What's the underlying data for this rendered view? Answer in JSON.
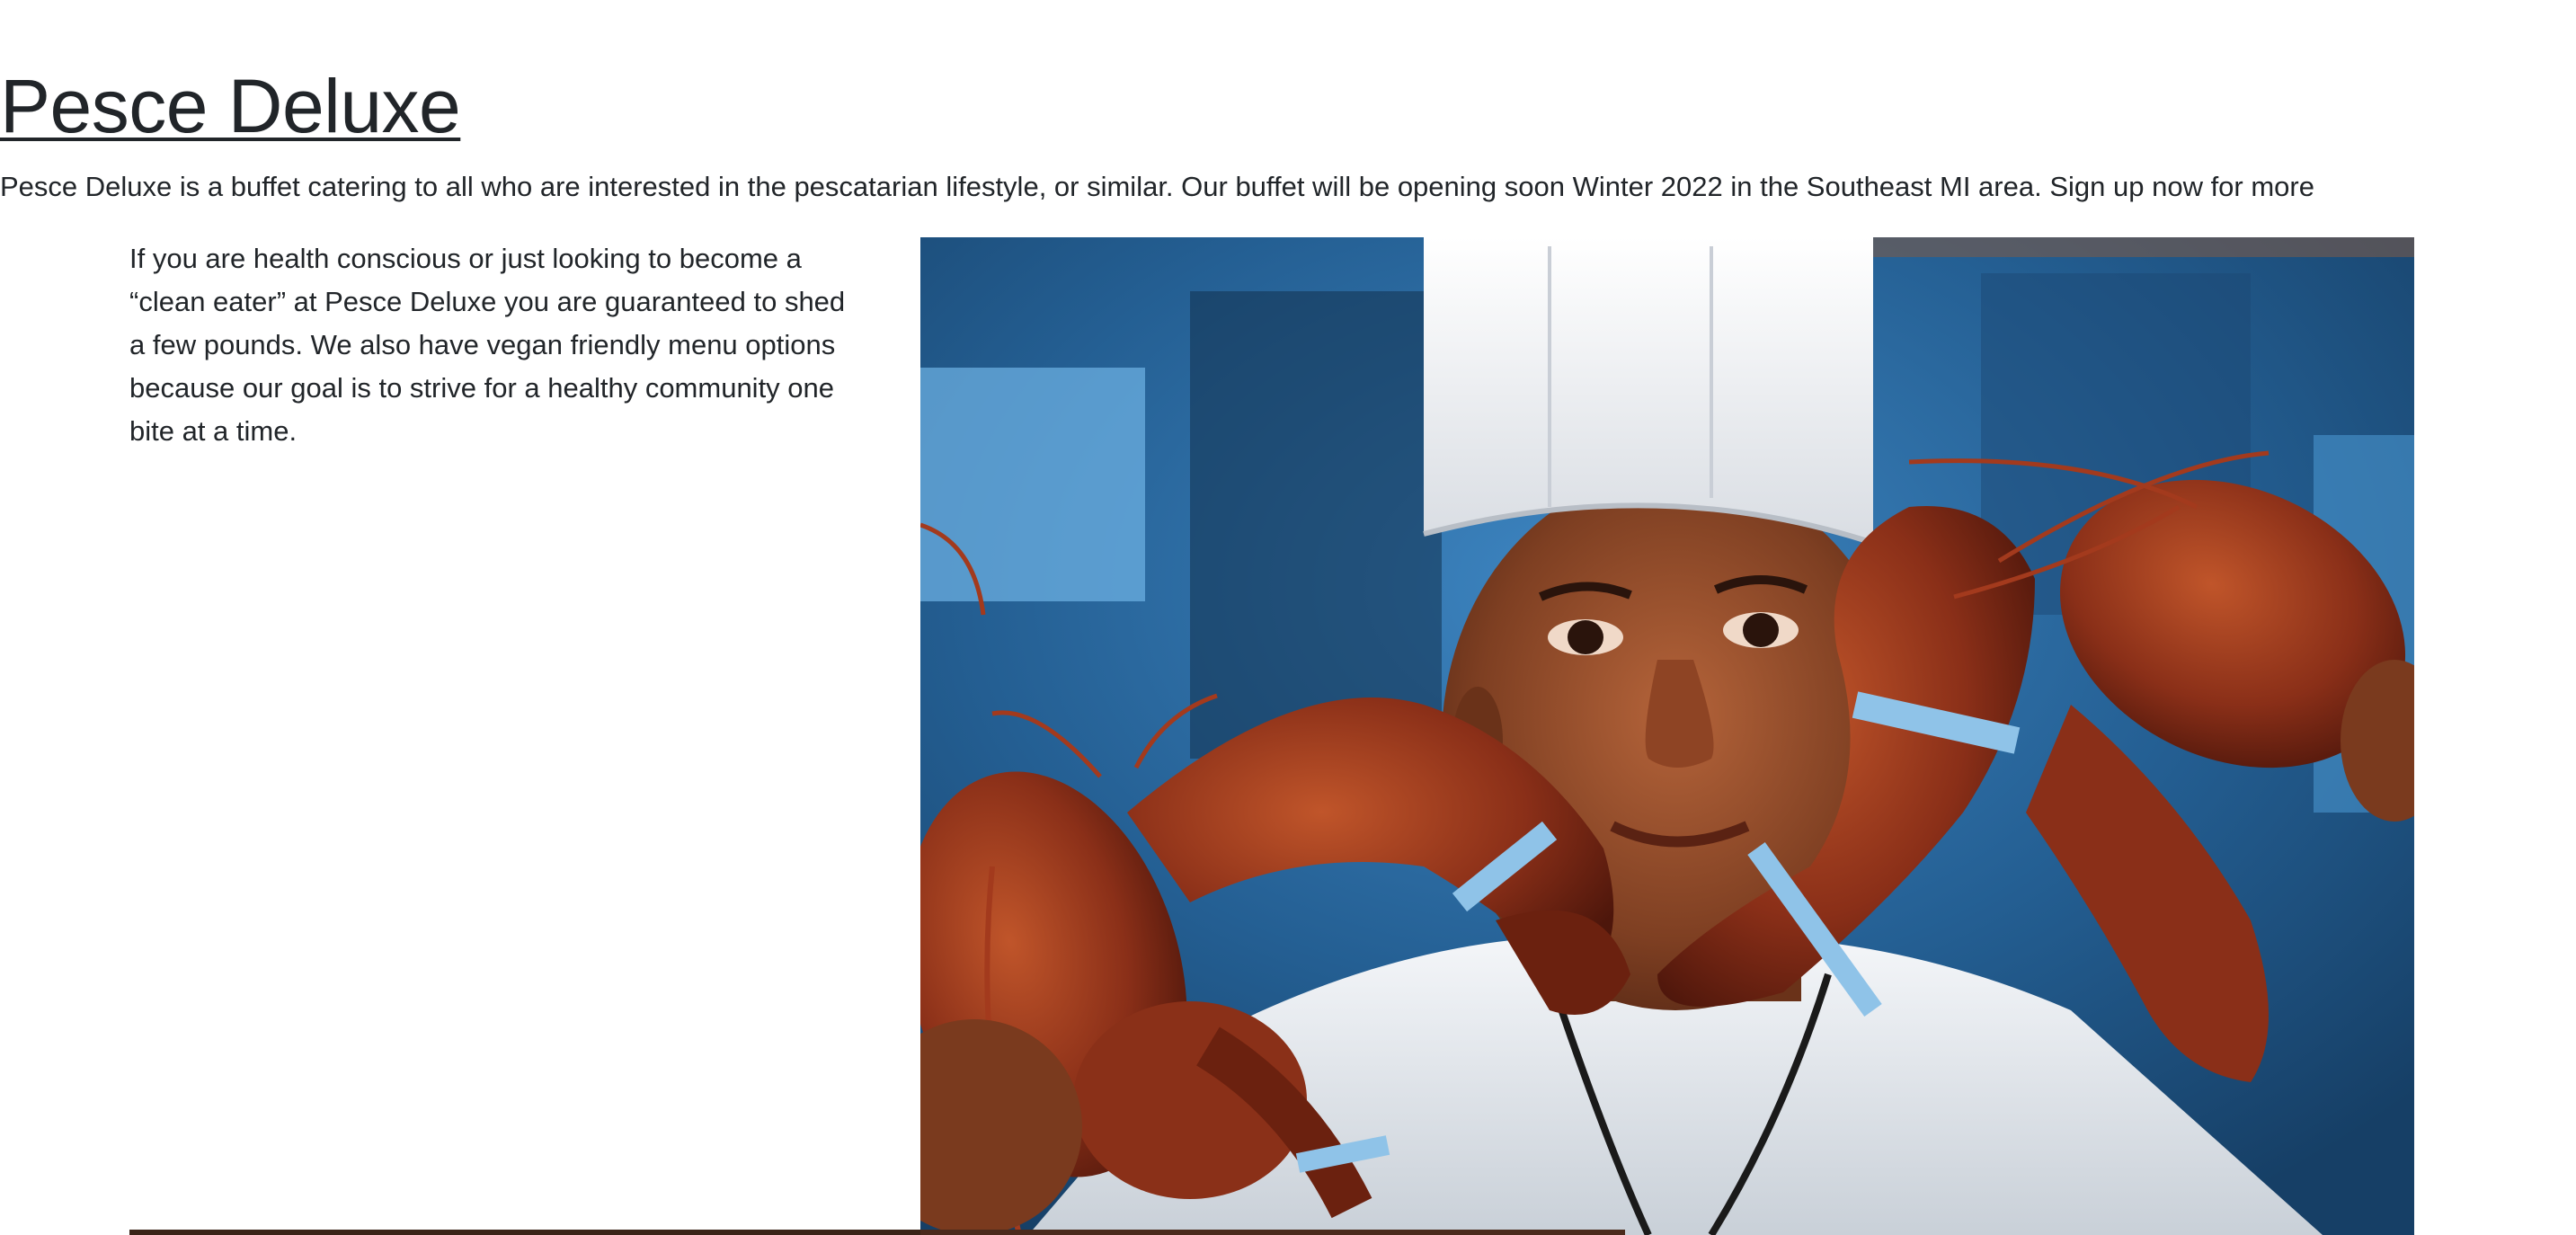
{
  "header": {
    "title": "Pesce Deluxe"
  },
  "intro": {
    "text": "Pesce Deluxe is a buffet catering to all who are interested in the pescatarian lifestyle, or similar. Our buffet will be opening soon Winter 2022 in the Southeast MI area. Sign up now for more"
  },
  "content": {
    "body": "If you are health conscious or just looking to become a “clean eater” at Pesce Deluxe you are guaranteed to shed a few pounds. We also have vegan friendly menu options because our goal is to strive for a healthy community one bite at a time."
  },
  "hero": {
    "icon": "photo-chef-holding-lobsters",
    "colors": {
      "background": "#2f6fa8",
      "chef_hat": "#f2f4f7",
      "skin": "#8a4a2c",
      "lobster": "#9c3a1e",
      "band": "#8fc3e8"
    }
  }
}
